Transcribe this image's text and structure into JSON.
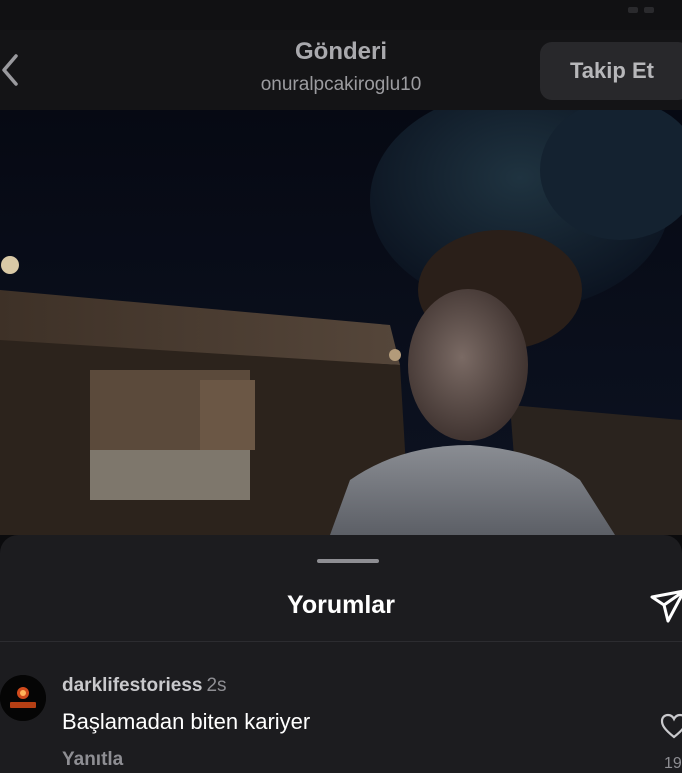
{
  "header": {
    "title": "Gönderi",
    "username": "onuralpcakiroglu10",
    "follow_label": "Takip Et",
    "back_icon": "chevron-left-icon"
  },
  "post": {
    "photo_description_icon": "photo"
  },
  "comments_sheet": {
    "title": "Yorumlar",
    "share_icon": "send-icon",
    "comments": [
      {
        "username": "darklifestoriess",
        "time": "2s",
        "text": "Başlamadan biten kariyer",
        "reply_label": "Yanıtla",
        "like_count": "19"
      }
    ]
  },
  "colors": {
    "background": "#0b0b0d",
    "sheet": "#1c1c1f",
    "follow_button": "#28282b"
  }
}
